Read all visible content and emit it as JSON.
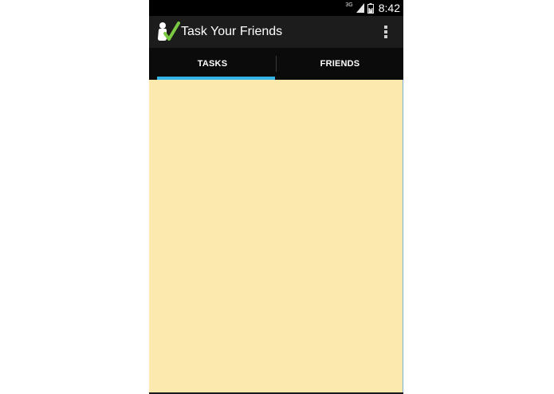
{
  "status_bar": {
    "network_type": "3G",
    "time": "8:42",
    "signal_icon": "signal-bars-icon",
    "battery_icon": "battery-charging-icon"
  },
  "action_bar": {
    "app_icon": "app-logo-icon",
    "title": "Task Your Friends",
    "overflow_icon": "overflow-menu-icon"
  },
  "tabs": [
    {
      "label": "TASKS",
      "selected": true
    },
    {
      "label": "FRIENDS",
      "selected": false
    }
  ],
  "colors": {
    "status_bar_bg": "#000000",
    "action_bar_bg": "#1c1c1c",
    "tab_bar_bg": "#0b0b0b",
    "tab_indicator": "#33b5e5",
    "content_bg": "#fbe9ad",
    "logo_check": "#7ac943"
  }
}
